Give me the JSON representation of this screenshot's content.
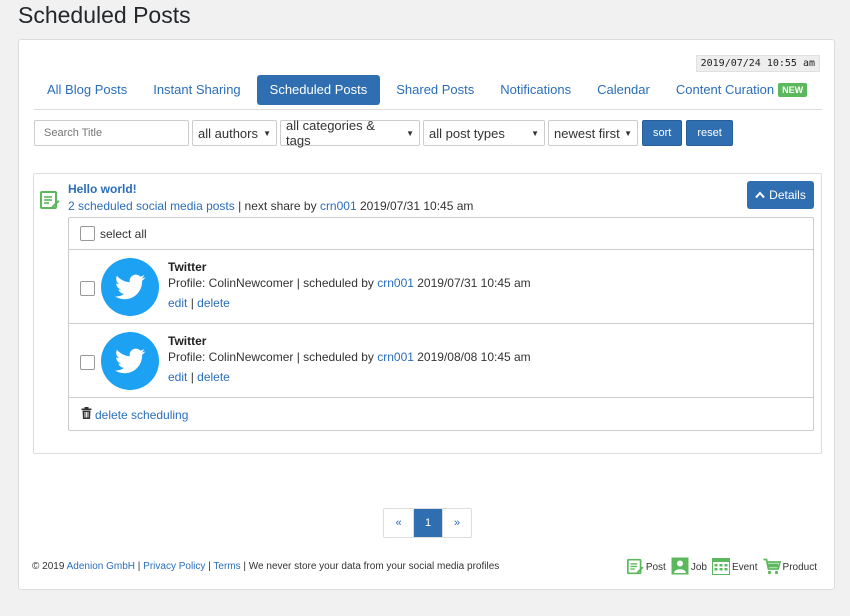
{
  "page": {
    "title": "Scheduled Posts"
  },
  "clock": "2019/07/24 10:55 am",
  "tabs": [
    {
      "label": "All Blog Posts"
    },
    {
      "label": "Instant Sharing"
    },
    {
      "label": "Scheduled Posts"
    },
    {
      "label": "Shared Posts"
    },
    {
      "label": "Notifications"
    },
    {
      "label": "Calendar"
    },
    {
      "label": "Content Curation",
      "badge": "NEW"
    }
  ],
  "filters": {
    "search_placeholder": "Search Title",
    "authors": "all authors",
    "categories": "all categories & tags",
    "post_types": "all post types",
    "order": "newest first",
    "sort_label": "sort",
    "reset_label": "reset"
  },
  "post": {
    "title": "Hello world!",
    "scheduled_link": "2 scheduled social media posts",
    "next_share_text": " | next share by ",
    "next_share_user": "crn001",
    "next_share_date": " 2019/07/31 10:45 am",
    "details_label": "Details",
    "select_all_label": "select all",
    "delete_scheduling_label": "delete scheduling",
    "shares": [
      {
        "network": "Twitter",
        "profile_text": "Profile: ColinNewcomer | scheduled by ",
        "user": "crn001",
        "date": " 2019/07/31 10:45 am",
        "edit_label": "edit",
        "sep": " | ",
        "delete_label": "delete"
      },
      {
        "network": "Twitter",
        "profile_text": "Profile: ColinNewcomer | scheduled by ",
        "user": "crn001",
        "date": " 2019/08/08 10:45 am",
        "edit_label": "edit",
        "sep": " | ",
        "delete_label": "delete"
      }
    ]
  },
  "pagination": {
    "prev": "«",
    "current": "1",
    "next": "»"
  },
  "footer": {
    "copyright": "© 2019 ",
    "company": "Adenion GmbH",
    "sep1": " | ",
    "privacy": "Privacy Policy",
    "sep2": " | ",
    "terms": "Terms",
    "note": " | We never store your data from your social media profiles",
    "links": [
      "Post",
      "Job",
      "Event",
      "Product"
    ]
  },
  "colors": {
    "accent": "#2f6fb1",
    "twitter": "#1da1f2",
    "green": "#5cb85c"
  }
}
